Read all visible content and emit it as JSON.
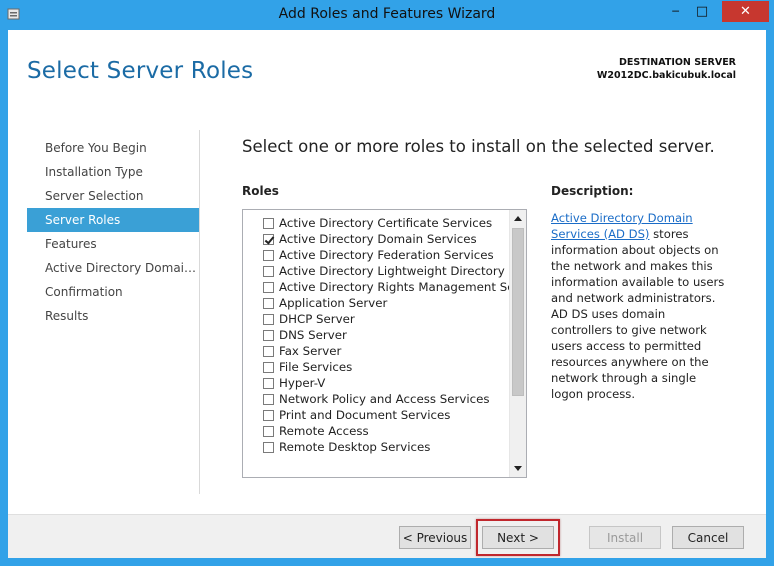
{
  "window": {
    "title": "Add Roles and Features Wizard",
    "minimize_glyph": "─",
    "maximize_glyph": "□",
    "close_glyph": "✕"
  },
  "header": {
    "page_title": "Select Server Roles",
    "destination_label": "DESTINATION SERVER",
    "destination_server": "W2012DC.bakicubuk.local"
  },
  "nav": {
    "items": [
      {
        "label": "Before You Begin",
        "active": false
      },
      {
        "label": "Installation Type",
        "active": false
      },
      {
        "label": "Server Selection",
        "active": false
      },
      {
        "label": "Server Roles",
        "active": true
      },
      {
        "label": "Features",
        "active": false
      },
      {
        "label": "Active Directory Domain...",
        "active": false
      },
      {
        "label": "Confirmation",
        "active": false
      },
      {
        "label": "Results",
        "active": false
      }
    ]
  },
  "main": {
    "instruction": "Select one or more roles to install on the selected server.",
    "roles_label": "Roles",
    "description_label": "Description:",
    "roles": [
      {
        "label": "Active Directory Certificate Services",
        "checked": false
      },
      {
        "label": "Active Directory Domain Services",
        "checked": true
      },
      {
        "label": "Active Directory Federation Services",
        "checked": false
      },
      {
        "label": "Active Directory Lightweight Directory Services",
        "checked": false
      },
      {
        "label": "Active Directory Rights Management Services",
        "checked": false
      },
      {
        "label": "Application Server",
        "checked": false
      },
      {
        "label": "DHCP Server",
        "checked": false
      },
      {
        "label": "DNS Server",
        "checked": false
      },
      {
        "label": "Fax Server",
        "checked": false
      },
      {
        "label": "File Services",
        "checked": false
      },
      {
        "label": "Hyper-V",
        "checked": false
      },
      {
        "label": "Network Policy and Access Services",
        "checked": false
      },
      {
        "label": "Print and Document Services",
        "checked": false
      },
      {
        "label": "Remote Access",
        "checked": false
      },
      {
        "label": "Remote Desktop Services",
        "checked": false
      }
    ],
    "description": {
      "link": "Active Directory Domain Services (AD DS)",
      "text": " stores information about objects on the network and makes this information available to users and network administrators. AD DS uses domain controllers to give network users access to permitted resources anywhere on the network through a single logon process."
    }
  },
  "footer": {
    "previous_label": "< Previous",
    "next_label": "Next >",
    "install_label": "Install",
    "cancel_label": "Cancel"
  },
  "colors": {
    "frame": "#32a2e8",
    "title_accent": "#1b6ba5",
    "nav_active": "#3aa0d6",
    "close_button": "#c7372f",
    "highlight": "#c0272d"
  }
}
